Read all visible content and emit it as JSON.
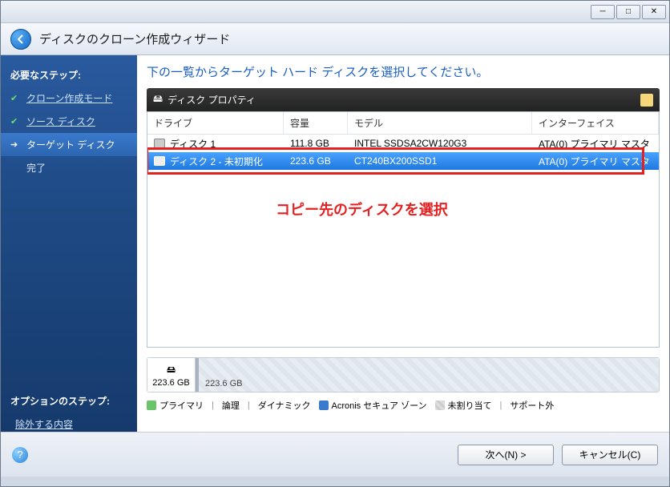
{
  "window": {
    "title": "ディスクのクローン作成ウィザード"
  },
  "sidebar": {
    "required_title": "必要なステップ:",
    "steps": [
      {
        "label": "クローン作成モード",
        "state": "done"
      },
      {
        "label": "ソース ディスク",
        "state": "done"
      },
      {
        "label": "ターゲット ディスク",
        "state": "current"
      },
      {
        "label": "完了",
        "state": "pending"
      }
    ],
    "optional_title": "オプションのステップ:",
    "optional_steps": [
      {
        "label": "除外する内容"
      }
    ]
  },
  "main": {
    "instruction": "下の一覧からターゲット ハード ディスクを選択してください。",
    "panel_title": "ディスク プロパティ",
    "columns": {
      "drive": "ドライブ",
      "capacity": "容量",
      "model": "モデル",
      "interface": "インターフェイス"
    },
    "rows": [
      {
        "drive": "ディスク 1",
        "capacity": "111.8 GB",
        "model": "INTEL SSDSA2CW120G3",
        "interface": "ATA(0) プライマリ マスタ",
        "selected": false
      },
      {
        "drive": "ディスク 2 - 未初期化",
        "capacity": "223.6 GB",
        "model": "CT240BX200SSD1",
        "interface": "ATA(0) プライマリ マスタ",
        "selected": true
      }
    ],
    "annotation": "コピー先のディスクを選択",
    "disk_map": {
      "label": "223.6 GB",
      "bar_label": "223.6 GB"
    },
    "legend": {
      "primary": "プライマリ",
      "logical": "論理",
      "dynamic": "ダイナミック",
      "acronis": "Acronis セキュア ゾーン",
      "unallocated": "未割り当て",
      "unsupported": "サポート外"
    }
  },
  "footer": {
    "next": "次へ(N) >",
    "cancel": "キャンセル(C)"
  }
}
